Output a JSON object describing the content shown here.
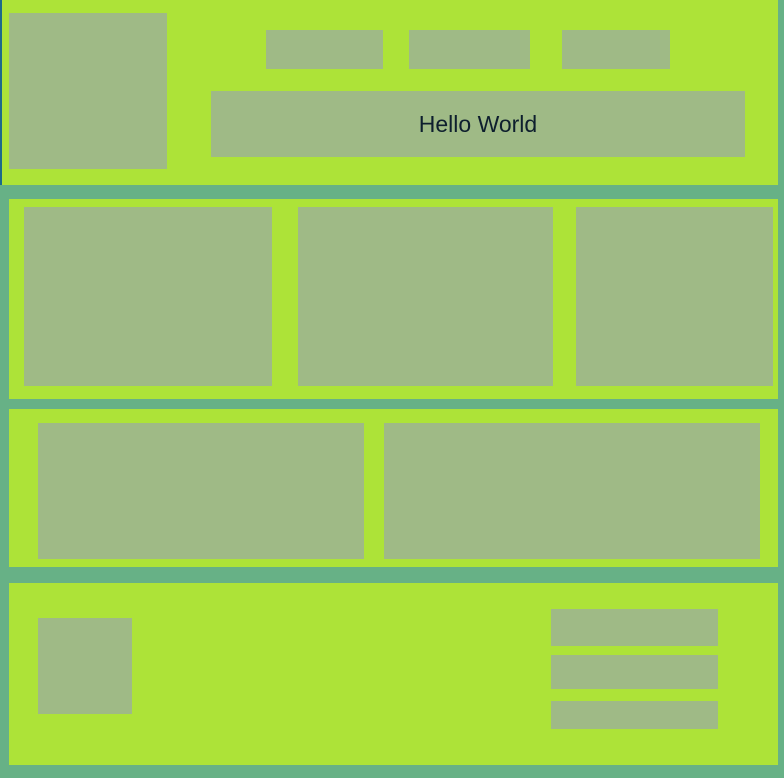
{
  "header": {
    "banner_text": "Hello World"
  }
}
